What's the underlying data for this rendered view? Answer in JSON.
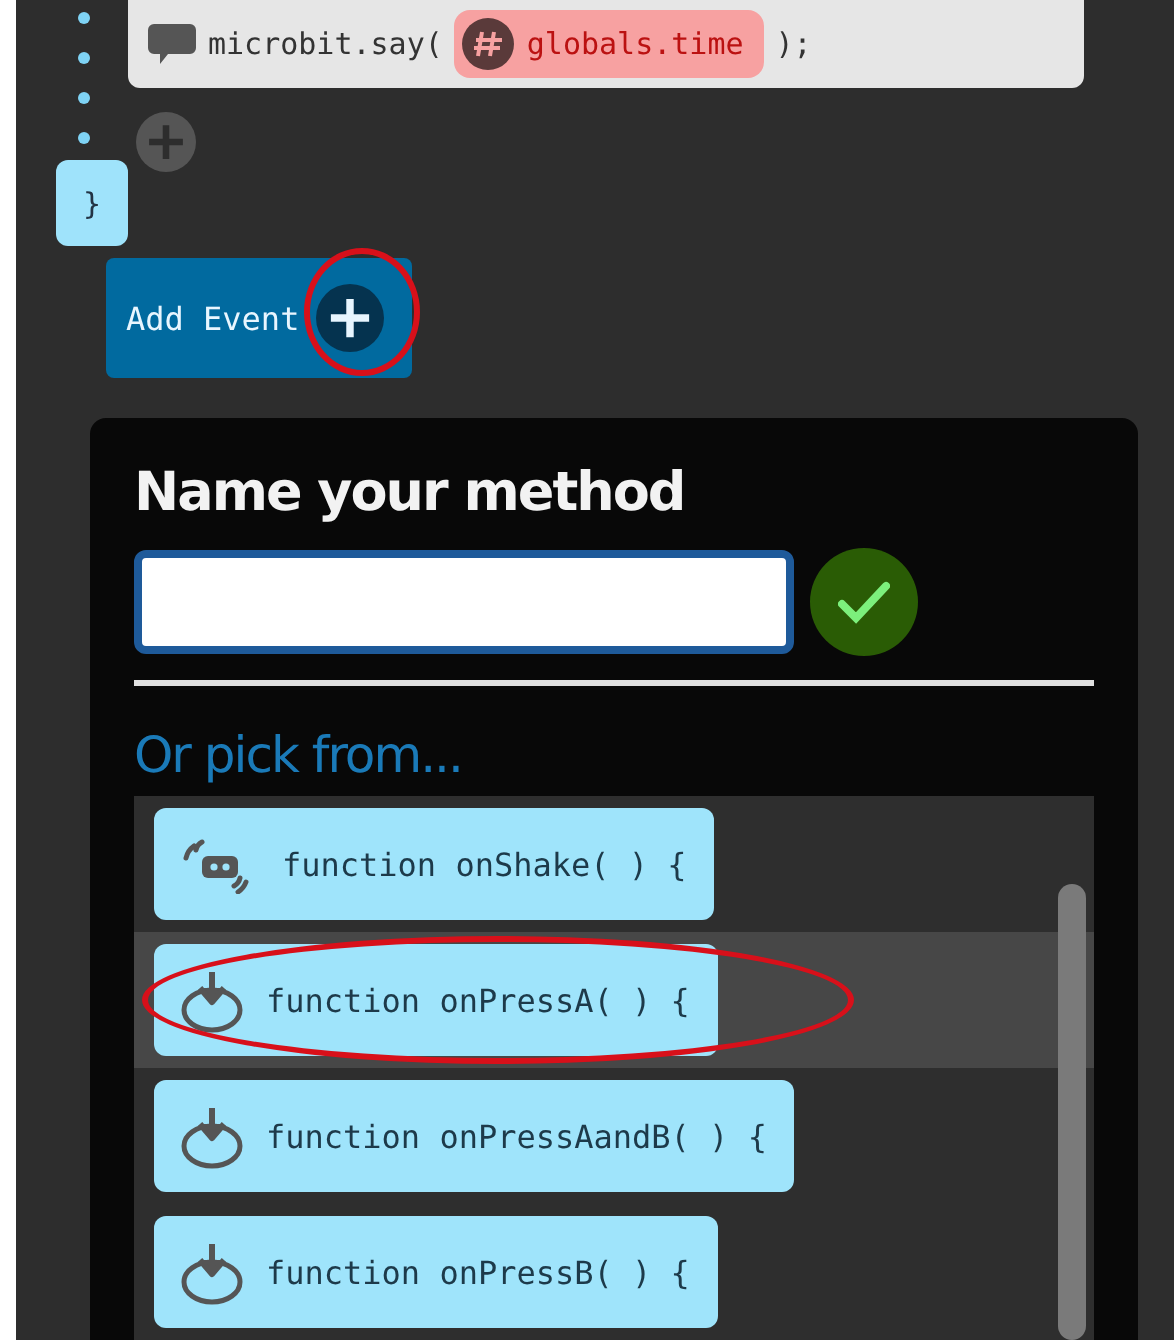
{
  "code": {
    "statement": "microbit.say(",
    "variable": "globals.time",
    "end": ");",
    "closing_brace": "}"
  },
  "add_event_button": {
    "label": "Add Event",
    "highlighted": true
  },
  "dialog": {
    "title": "Name your method",
    "pick_label": "Or pick from...",
    "items": [
      {
        "label": "function onShake( ) {",
        "kind": "shake",
        "selected": false,
        "highlighted": false
      },
      {
        "label": "function onPressA( ) {",
        "kind": "press",
        "selected": true,
        "highlighted": true
      },
      {
        "label": "function onPressAandB( ) {",
        "kind": "press",
        "selected": false,
        "highlighted": false
      },
      {
        "label": "function onPressB( ) {",
        "kind": "press",
        "selected": false,
        "highlighted": false
      }
    ]
  }
}
